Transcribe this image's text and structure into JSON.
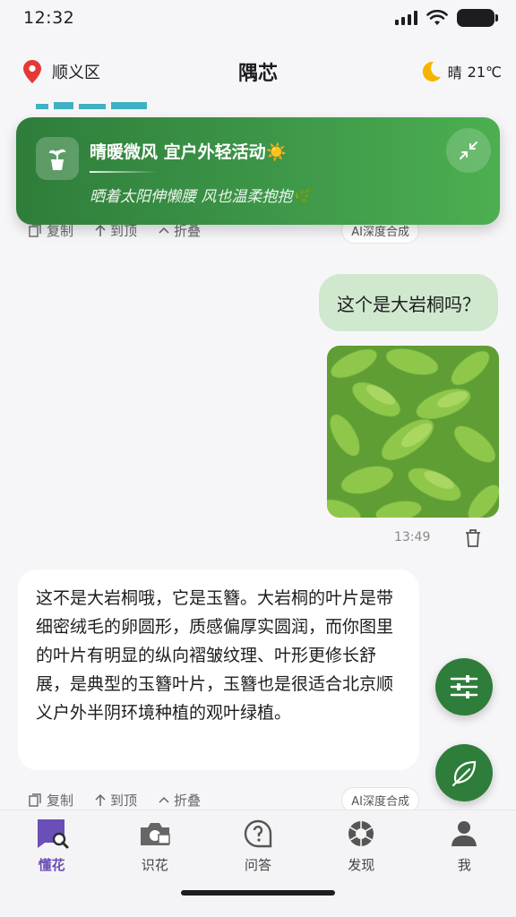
{
  "status_bar": {
    "time": "12:32"
  },
  "header": {
    "location": "顺义区",
    "title": "隅芯",
    "weather_condition": "晴",
    "temperature": "21℃",
    "location_icon": "location-pin-icon",
    "weather_icon": "crescent-moon-icon"
  },
  "banner": {
    "title": "晴暖微风 宜户外轻活动☀️",
    "subtitle": "晒着太阳伸懒腰 风也温柔抱抱🌿",
    "icon": "potted-plant-icon",
    "collapse_icon": "collapse-arrows-icon"
  },
  "top_actions": {
    "copy": "复制",
    "to_top": "到顶",
    "collapse": "折叠",
    "ai_badge": "AI深度合成"
  },
  "conversation": {
    "user_message": "这个是大岩桐吗？",
    "photo_time": "13:49",
    "bot_message": "这不是大岩桐哦，它是玉簪。大岩桐的叶片是带细密绒毛的卵圆形，质感偏厚实圆润，而你图里的叶片有明显的纵向褶皱纹理、叶形更修长舒展，是典型的玉簪叶片，玉簪也是很适合北京顺义户外半阴环境种植的观叶绿植。"
  },
  "bottom_actions": {
    "copy": "复制",
    "to_top": "到顶",
    "collapse": "折叠",
    "ai_badge": "AI深度合成"
  },
  "fabs": {
    "filter_icon": "sliders-icon",
    "leaf_icon": "leaf-icon"
  },
  "tabbar": {
    "tabs": [
      {
        "label": "懂花",
        "icon": "chat-search-icon"
      },
      {
        "label": "识花",
        "icon": "camera-icon"
      },
      {
        "label": "问答",
        "icon": "question-bubble-icon"
      },
      {
        "label": "发现",
        "icon": "aperture-icon"
      },
      {
        "label": "我",
        "icon": "person-icon"
      }
    ]
  },
  "colors": {
    "accent_green": "#2e7d3a",
    "user_bubble": "#cfe8ce",
    "active_tab": "#6a4fb8",
    "location_red": "#e53935"
  }
}
